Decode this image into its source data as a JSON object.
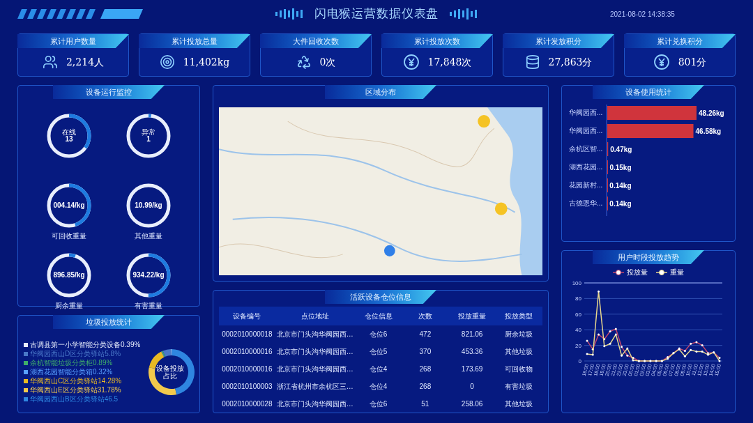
{
  "header": {
    "title": "闪电猴运营数据仪表盘",
    "timestamp": "2021-08-02 14:38:35"
  },
  "kpis": [
    {
      "label": "累计用户数量",
      "value": "2,214人",
      "kind": "users"
    },
    {
      "label": "累计投放总量",
      "value": "11,402kg",
      "kind": "target"
    },
    {
      "label": "大件回收次数",
      "value": "0次",
      "kind": "recycle"
    },
    {
      "label": "累计投放次数",
      "value": "17,848次",
      "kind": "yen"
    },
    {
      "label": "累计发放积分",
      "value": "27,863分",
      "kind": "coins"
    },
    {
      "label": "累计兑换积分",
      "value": "801分",
      "kind": "yen"
    }
  ],
  "device_monitor": {
    "title": "设备运行监控",
    "rings": [
      {
        "label": "在线",
        "value": "13",
        "level": 0.35
      },
      {
        "label": "异常",
        "value": "1",
        "level": 0.02
      },
      {
        "value": "004.14/kg",
        "caption": "可回收重量",
        "level": 0.45
      },
      {
        "value": "10.99/kg",
        "caption": "其他重量",
        "level": 0
      },
      {
        "value": "896.85/kg",
        "caption": "厨余重量",
        "level": 0.05
      },
      {
        "value": "934.22/kg",
        "caption": "有害重量",
        "level": 0.5
      }
    ]
  },
  "region_map": {
    "title": "区域分布"
  },
  "device_usage": {
    "title": "设备使用统计",
    "chart_data": {
      "type": "bar",
      "orientation": "horizontal",
      "categories": [
        "华阀园西...",
        "华阀园西...",
        "余杭区智...",
        "湖西花园...",
        "花园新村...",
        "古德恩华..."
      ],
      "values": [
        48.26,
        46.58,
        0.47,
        0.15,
        0.14,
        0.14
      ],
      "data_labels": true,
      "value_labels": [
        "48.26kg",
        "46.58kg",
        "0.47kg",
        "0.15kg",
        "0.14kg",
        "0.14kg"
      ]
    }
  },
  "user_trend": {
    "title": "用户时段投放趋势",
    "chart_data": {
      "type": "line",
      "categories": [
        "16:00",
        "17:00",
        "18:00",
        "19:00",
        "20:00",
        "21:00",
        "22:00",
        "23:00",
        "00:00",
        "01:00",
        "02:00",
        "03:00",
        "04:00",
        "05:00",
        "06:00",
        "07:00",
        "08:00",
        "09:00",
        "10:00",
        "11:00",
        "12:00",
        "13:00",
        "14:00",
        "15:00"
      ],
      "ylim": [
        0,
        100
      ],
      "grid": true,
      "yticks": [
        0,
        20,
        40,
        60,
        80,
        100
      ],
      "series": [
        {
          "name": "投放量",
          "color": "#c2466e",
          "values": [
            26,
            15,
            34,
            28,
            38,
            41,
            18,
            7,
            4,
            0,
            0,
            0,
            0,
            0,
            5,
            10,
            16,
            13,
            22,
            24,
            20,
            10,
            11,
            4
          ]
        },
        {
          "name": "重量",
          "color": "#e6d68c",
          "values": [
            9,
            8,
            89,
            19,
            22,
            34,
            7,
            16,
            1,
            0,
            0,
            0,
            0,
            0,
            3,
            10,
            15,
            6,
            14,
            12,
            12,
            8,
            11,
            0
          ]
        }
      ]
    }
  },
  "garbage_stats": {
    "title": "垃圾投放统计",
    "chart_data": {
      "type": "donut",
      "title": "设备投放占比",
      "categories": [
        "古调县第一小学智能分类设备",
        "华阀园西山D区分类驿站",
        "余杭智能垃圾分类柜",
        "湖西花园智能分类箱",
        "华阀西山C区分类驿站",
        "华阀西山E区分类驿站",
        "华阀园西山B区分类驿站"
      ],
      "values": [
        0.39,
        5.8,
        0.89,
        0.32,
        14.28,
        31.78,
        46.5
      ],
      "value_labels": [
        "0.39%",
        "5.8%",
        "0.89%",
        "0.32%",
        "14.28%",
        "31.78%",
        "46.5"
      ],
      "legend": "left",
      "colors": [
        "#e8eefc",
        "#4a78c8",
        "#3fae6a",
        "#5aa0ff",
        "#e8b923",
        "#f2c94c",
        "#2f86e0"
      ]
    }
  },
  "device_slots": {
    "title": "活跃设备仓位信息",
    "columns": [
      "设备编号",
      "点位地址",
      "仓位信息",
      "次数",
      "投放重量",
      "投放类型"
    ],
    "rows": [
      [
        "0002010000018",
        "北京市门头沟华阀园西…",
        "仓位6",
        "472",
        "821.06",
        "厨余垃圾"
      ],
      [
        "0002010000016",
        "北京市门头沟华阀园西…",
        "仓位5",
        "370",
        "453.36",
        "其他垃圾"
      ],
      [
        "0002010000016",
        "北京市门头沟华阀园西…",
        "仓位4",
        "268",
        "173.69",
        "可回收物"
      ],
      [
        "0002010100003",
        "浙江省杭州市余杭区三…",
        "仓位4",
        "268",
        "0",
        "有害垃圾"
      ],
      [
        "0002010000028",
        "北京市门头沟华阀园西…",
        "仓位6",
        "51",
        "258.06",
        "其他垃圾"
      ]
    ]
  }
}
